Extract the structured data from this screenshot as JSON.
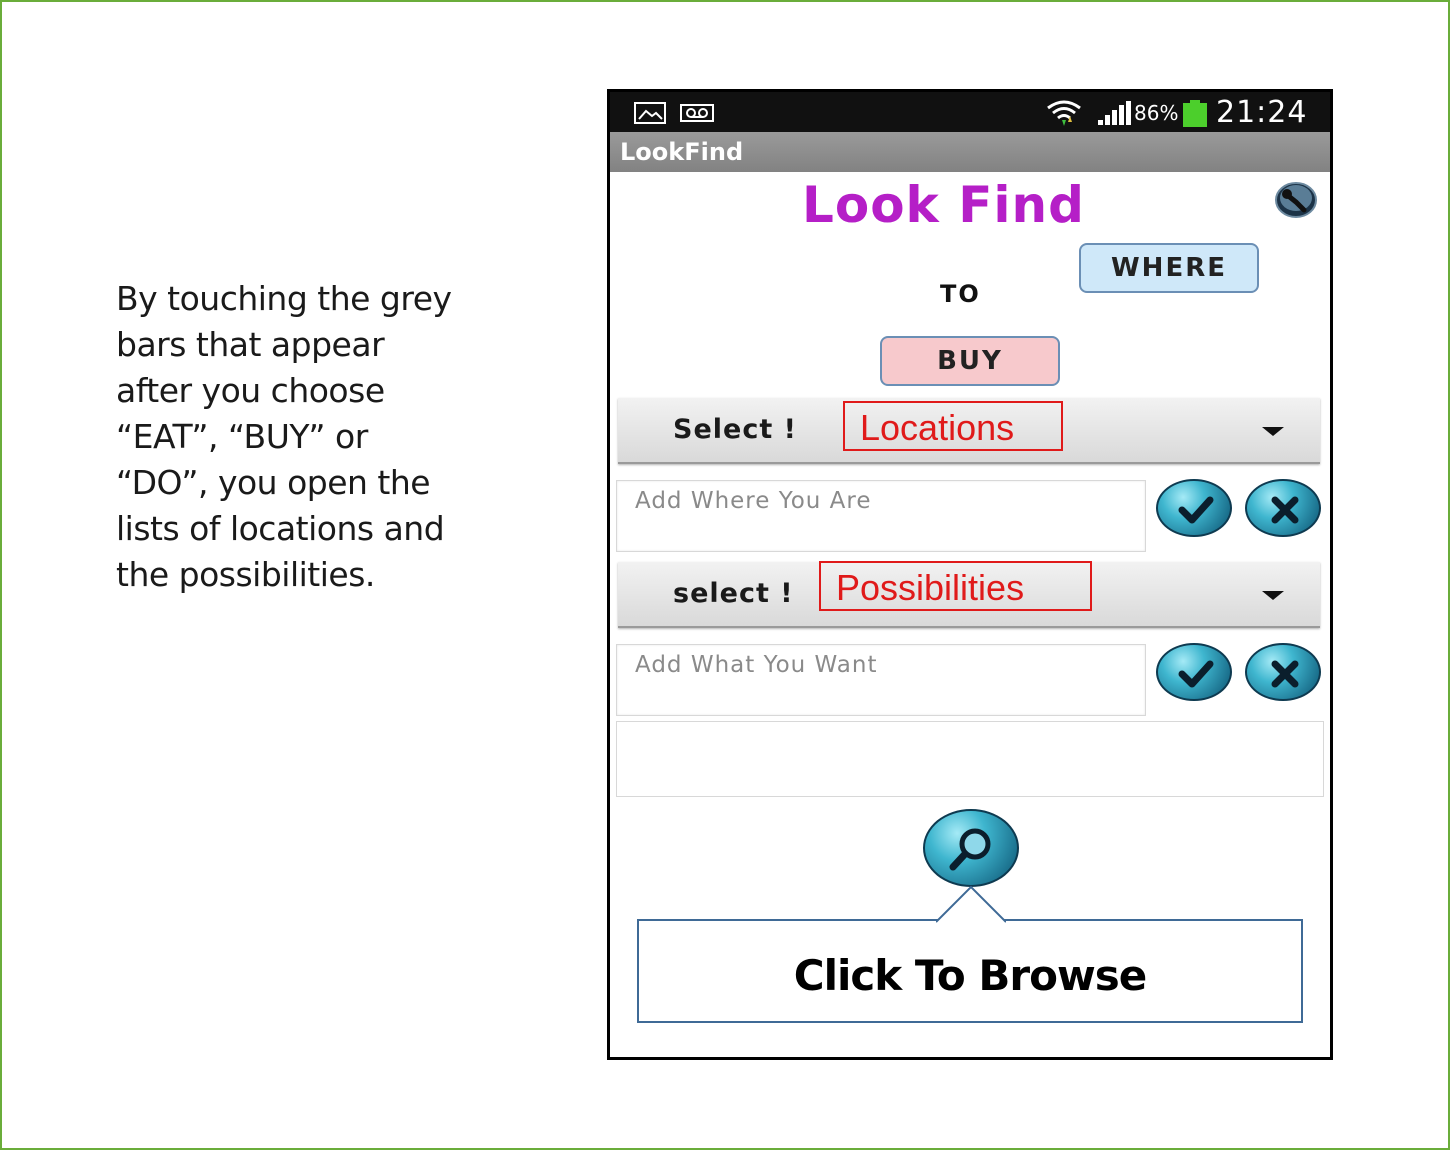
{
  "caption": {
    "lines": [
      "By touching the grey",
      "bars that appear",
      "after you choose",
      "“EAT”, “BUY” or",
      "“DO”, you open the",
      "lists of locations and",
      "the possibilities."
    ]
  },
  "status_bar": {
    "battery": "86%",
    "time": "21:24",
    "icons": [
      "image-icon",
      "voicemail-icon",
      "wifi-icon",
      "signal-icon",
      "battery-icon"
    ]
  },
  "app": {
    "title": "LookFind",
    "logo_text": "Look Find",
    "where_label": "WHERE",
    "to_label": "TO",
    "buy_label": "BUY"
  },
  "spinners": {
    "locations": {
      "label": "Select !",
      "callout": "Locations"
    },
    "possibilities": {
      "label": "select !",
      "callout": "Possibilities"
    }
  },
  "inputs": {
    "where_placeholder": "Add Where You Are",
    "what_placeholder": "Add What You Want"
  },
  "browse": {
    "label": "Click To Browse"
  },
  "colors": {
    "logo": "#b51fc7",
    "callout_red": "#e01a1a",
    "frame_green": "#6aad3a",
    "where_bubble": "#cfe8f9",
    "buy_bubble": "#f7c9cc",
    "button_teal": "#3fb6cf"
  }
}
